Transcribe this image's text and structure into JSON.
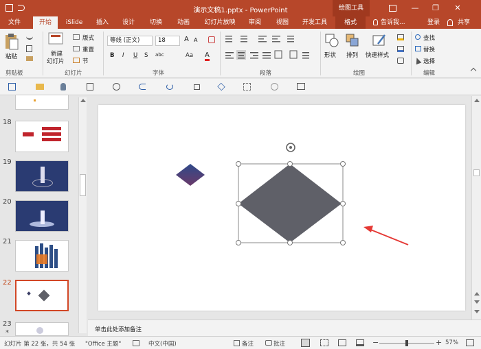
{
  "window": {
    "title": "演示文稿1.pptx - PowerPoint",
    "context_tool": "绘图工具",
    "buttons": {
      "minimize": "—",
      "restore": "❐",
      "close": "✕"
    }
  },
  "tabs": [
    {
      "label": "文件"
    },
    {
      "label": "开始"
    },
    {
      "label": "iSlide"
    },
    {
      "label": "插入"
    },
    {
      "label": "设计"
    },
    {
      "label": "切换"
    },
    {
      "label": "动画"
    },
    {
      "label": "幻灯片放映"
    },
    {
      "label": "审阅"
    },
    {
      "label": "视图"
    },
    {
      "label": "开发工具"
    },
    {
      "label": "格式"
    }
  ],
  "tell_me": "告诉我...",
  "login": "登录",
  "share": "共享",
  "ribbon": {
    "clipboard": {
      "paste": "粘贴",
      "group": "剪贴板"
    },
    "slides": {
      "new_slide_line1": "新建",
      "new_slide_line2": "幻灯片",
      "layout": "版式",
      "reset": "重置",
      "section": "节",
      "group": "幻灯片"
    },
    "font": {
      "font_name": "等线 (正文)",
      "font_size": "18",
      "bold": "B",
      "italic": "I",
      "underline": "U",
      "strike": "S",
      "char_spacing": "abc",
      "case": "Aa",
      "grow": "A",
      "shrink": "A",
      "color": "A",
      "group": "字体"
    },
    "paragraph": {
      "group": "段落"
    },
    "drawing": {
      "shapes": "形状",
      "arrange": "排列",
      "quick_styles": "快速样式",
      "group": "绘图"
    },
    "editing": {
      "find": "查找",
      "replace": "替换",
      "select": "选择",
      "group": "编辑"
    }
  },
  "thumbnails": [
    {
      "num": "18"
    },
    {
      "num": "19"
    },
    {
      "num": "20"
    },
    {
      "num": "21"
    },
    {
      "num": "22"
    },
    {
      "num": "23"
    }
  ],
  "notes_placeholder": "单击此处添加备注",
  "status": {
    "slide_info": "幻灯片 第 22 张，共 54 张",
    "theme": "\"Office 主题\"",
    "language": "中文(中国)",
    "notes": "备注",
    "comments": "批注",
    "zoom": "57%"
  },
  "colors": {
    "accent": "#b7472a",
    "diamond": "#5f6068",
    "arrow": "#e53935"
  }
}
